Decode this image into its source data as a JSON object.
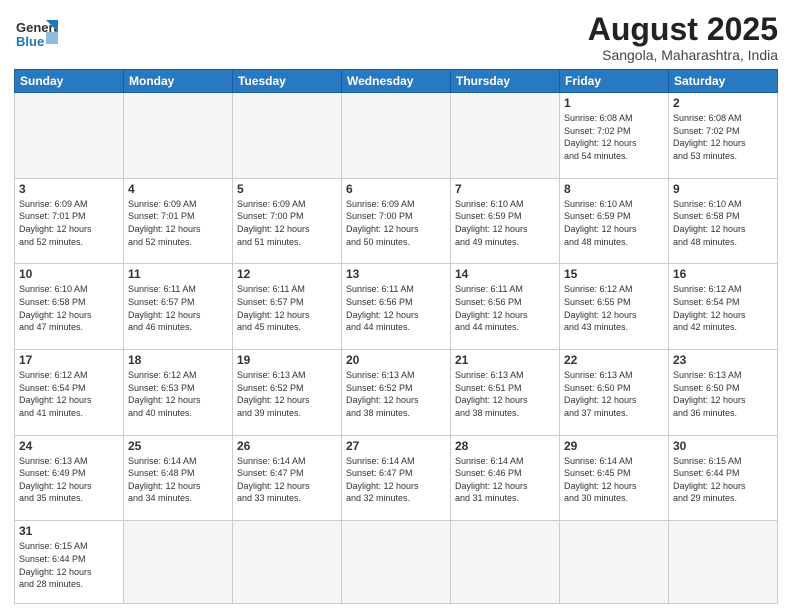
{
  "header": {
    "logo_general": "General",
    "logo_blue": "Blue",
    "month_year": "August 2025",
    "location": "Sangola, Maharashtra, India"
  },
  "weekdays": [
    "Sunday",
    "Monday",
    "Tuesday",
    "Wednesday",
    "Thursday",
    "Friday",
    "Saturday"
  ],
  "weeks": [
    [
      {
        "day": "",
        "info": ""
      },
      {
        "day": "",
        "info": ""
      },
      {
        "day": "",
        "info": ""
      },
      {
        "day": "",
        "info": ""
      },
      {
        "day": "",
        "info": ""
      },
      {
        "day": "1",
        "info": "Sunrise: 6:08 AM\nSunset: 7:02 PM\nDaylight: 12 hours\nand 54 minutes."
      },
      {
        "day": "2",
        "info": "Sunrise: 6:08 AM\nSunset: 7:02 PM\nDaylight: 12 hours\nand 53 minutes."
      }
    ],
    [
      {
        "day": "3",
        "info": "Sunrise: 6:09 AM\nSunset: 7:01 PM\nDaylight: 12 hours\nand 52 minutes."
      },
      {
        "day": "4",
        "info": "Sunrise: 6:09 AM\nSunset: 7:01 PM\nDaylight: 12 hours\nand 52 minutes."
      },
      {
        "day": "5",
        "info": "Sunrise: 6:09 AM\nSunset: 7:00 PM\nDaylight: 12 hours\nand 51 minutes."
      },
      {
        "day": "6",
        "info": "Sunrise: 6:09 AM\nSunset: 7:00 PM\nDaylight: 12 hours\nand 50 minutes."
      },
      {
        "day": "7",
        "info": "Sunrise: 6:10 AM\nSunset: 6:59 PM\nDaylight: 12 hours\nand 49 minutes."
      },
      {
        "day": "8",
        "info": "Sunrise: 6:10 AM\nSunset: 6:59 PM\nDaylight: 12 hours\nand 48 minutes."
      },
      {
        "day": "9",
        "info": "Sunrise: 6:10 AM\nSunset: 6:58 PM\nDaylight: 12 hours\nand 48 minutes."
      }
    ],
    [
      {
        "day": "10",
        "info": "Sunrise: 6:10 AM\nSunset: 6:58 PM\nDaylight: 12 hours\nand 47 minutes."
      },
      {
        "day": "11",
        "info": "Sunrise: 6:11 AM\nSunset: 6:57 PM\nDaylight: 12 hours\nand 46 minutes."
      },
      {
        "day": "12",
        "info": "Sunrise: 6:11 AM\nSunset: 6:57 PM\nDaylight: 12 hours\nand 45 minutes."
      },
      {
        "day": "13",
        "info": "Sunrise: 6:11 AM\nSunset: 6:56 PM\nDaylight: 12 hours\nand 44 minutes."
      },
      {
        "day": "14",
        "info": "Sunrise: 6:11 AM\nSunset: 6:56 PM\nDaylight: 12 hours\nand 44 minutes."
      },
      {
        "day": "15",
        "info": "Sunrise: 6:12 AM\nSunset: 6:55 PM\nDaylight: 12 hours\nand 43 minutes."
      },
      {
        "day": "16",
        "info": "Sunrise: 6:12 AM\nSunset: 6:54 PM\nDaylight: 12 hours\nand 42 minutes."
      }
    ],
    [
      {
        "day": "17",
        "info": "Sunrise: 6:12 AM\nSunset: 6:54 PM\nDaylight: 12 hours\nand 41 minutes."
      },
      {
        "day": "18",
        "info": "Sunrise: 6:12 AM\nSunset: 6:53 PM\nDaylight: 12 hours\nand 40 minutes."
      },
      {
        "day": "19",
        "info": "Sunrise: 6:13 AM\nSunset: 6:52 PM\nDaylight: 12 hours\nand 39 minutes."
      },
      {
        "day": "20",
        "info": "Sunrise: 6:13 AM\nSunset: 6:52 PM\nDaylight: 12 hours\nand 38 minutes."
      },
      {
        "day": "21",
        "info": "Sunrise: 6:13 AM\nSunset: 6:51 PM\nDaylight: 12 hours\nand 38 minutes."
      },
      {
        "day": "22",
        "info": "Sunrise: 6:13 AM\nSunset: 6:50 PM\nDaylight: 12 hours\nand 37 minutes."
      },
      {
        "day": "23",
        "info": "Sunrise: 6:13 AM\nSunset: 6:50 PM\nDaylight: 12 hours\nand 36 minutes."
      }
    ],
    [
      {
        "day": "24",
        "info": "Sunrise: 6:13 AM\nSunset: 6:49 PM\nDaylight: 12 hours\nand 35 minutes."
      },
      {
        "day": "25",
        "info": "Sunrise: 6:14 AM\nSunset: 6:48 PM\nDaylight: 12 hours\nand 34 minutes."
      },
      {
        "day": "26",
        "info": "Sunrise: 6:14 AM\nSunset: 6:47 PM\nDaylight: 12 hours\nand 33 minutes."
      },
      {
        "day": "27",
        "info": "Sunrise: 6:14 AM\nSunset: 6:47 PM\nDaylight: 12 hours\nand 32 minutes."
      },
      {
        "day": "28",
        "info": "Sunrise: 6:14 AM\nSunset: 6:46 PM\nDaylight: 12 hours\nand 31 minutes."
      },
      {
        "day": "29",
        "info": "Sunrise: 6:14 AM\nSunset: 6:45 PM\nDaylight: 12 hours\nand 30 minutes."
      },
      {
        "day": "30",
        "info": "Sunrise: 6:15 AM\nSunset: 6:44 PM\nDaylight: 12 hours\nand 29 minutes."
      }
    ],
    [
      {
        "day": "31",
        "info": "Sunrise: 6:15 AM\nSunset: 6:44 PM\nDaylight: 12 hours\nand 28 minutes."
      },
      {
        "day": "",
        "info": ""
      },
      {
        "day": "",
        "info": ""
      },
      {
        "day": "",
        "info": ""
      },
      {
        "day": "",
        "info": ""
      },
      {
        "day": "",
        "info": ""
      },
      {
        "day": "",
        "info": ""
      }
    ]
  ]
}
